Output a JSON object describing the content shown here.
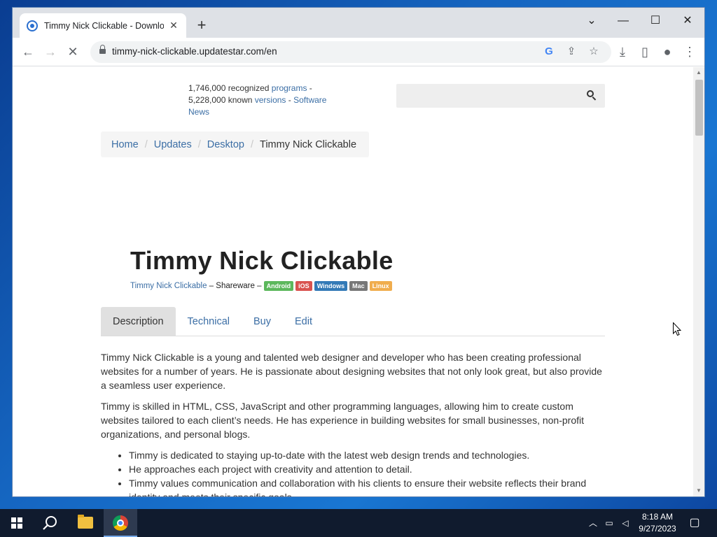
{
  "browser": {
    "tab": {
      "title": "Timmy Nick Clickable - Downloa",
      "favicon": "globe-icon"
    },
    "new_tab_label": "+",
    "url": "timmy-nick-clickable.updatestar.com/en"
  },
  "site": {
    "stats": {
      "recognized_count": "1,746,000 recognized",
      "programs_link": "programs",
      "sep1": " - ",
      "known_count": "5,228,000 known",
      "versions_link": "versions",
      "sep2": " - ",
      "news_link": "Software News"
    },
    "search": {
      "placeholder": ""
    },
    "breadcrumb": [
      "Home",
      "Updates",
      "Desktop",
      "Timmy Nick Clickable"
    ],
    "app": {
      "title": "Timmy Nick Clickable",
      "developer_link": "Timmy Nick Clickable",
      "license": " – Shareware – ",
      "platforms": [
        {
          "label": "Android",
          "color": "#5cb85c"
        },
        {
          "label": "iOS",
          "color": "#d9534f"
        },
        {
          "label": "Windows",
          "color": "#337ab7"
        },
        {
          "label": "Mac",
          "color": "#777777"
        },
        {
          "label": "Linux",
          "color": "#f0ad4e"
        }
      ]
    },
    "tabs": [
      "Description",
      "Technical",
      "Buy",
      "Edit"
    ],
    "description": {
      "p1": "Timmy Nick Clickable is a young and talented web designer and developer who has been creating professional websites for a number of years. He is passionate about designing websites that not only look great, but also provide a seamless user experience.",
      "p2": "Timmy is skilled in HTML, CSS, JavaScript and other programming languages, allowing him to create custom websites tailored to each client’s needs. He has experience in building websites for small businesses, non-profit organizations, and personal blogs.",
      "bullets": [
        "Timmy is dedicated to staying up-to-date with the latest web design trends and technologies.",
        "He approaches each project with creativity and attention to detail.",
        "Timmy values communication and collaboration with his clients to ensure their website reflects their brand identity and meets their specific goals."
      ]
    }
  },
  "taskbar": {
    "clock_time": "8:18 AM",
    "clock_date": "9/27/2023"
  }
}
